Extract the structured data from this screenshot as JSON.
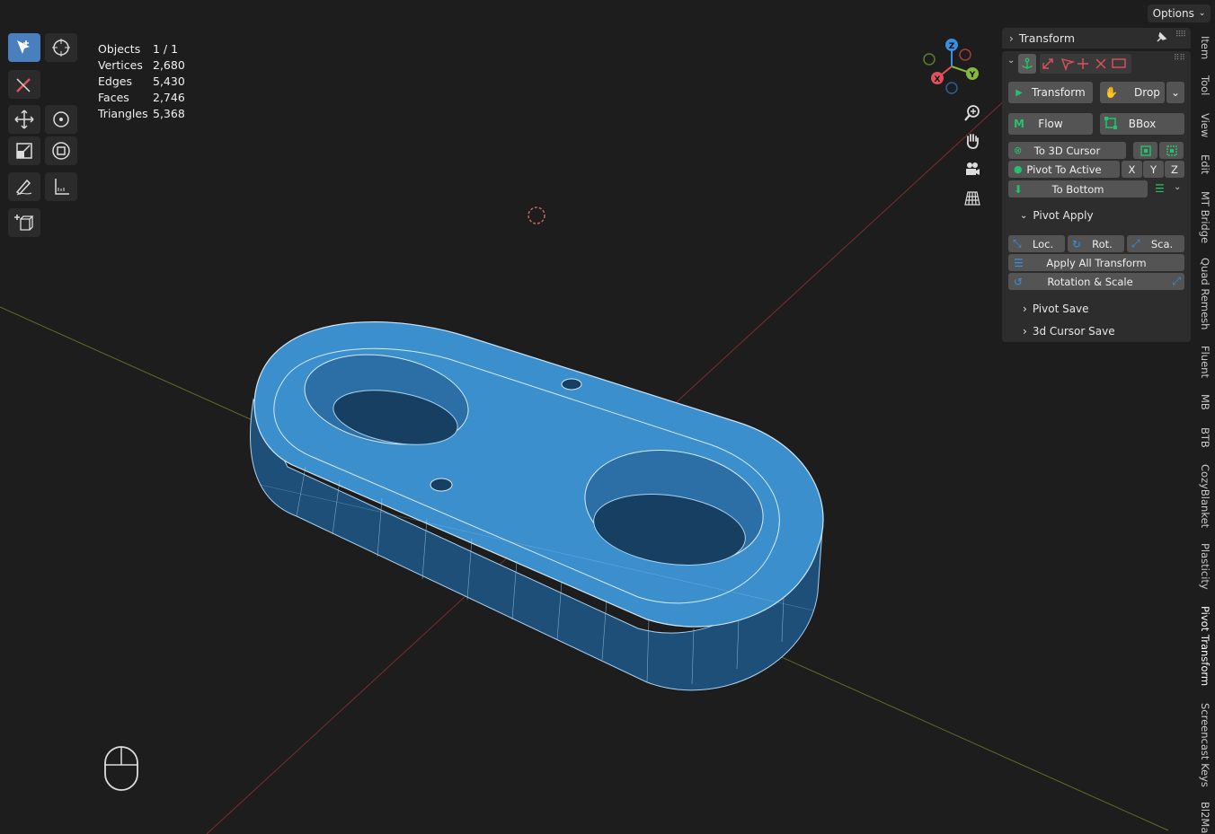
{
  "header": {
    "options_label": "Options"
  },
  "stats": [
    {
      "label": "Objects",
      "value": "1 / 1"
    },
    {
      "label": "Vertices",
      "value": "2,680"
    },
    {
      "label": "Edges",
      "value": "5,430"
    },
    {
      "label": "Faces",
      "value": "2,746"
    },
    {
      "label": "Triangles",
      "value": "5,368"
    }
  ],
  "gizmo": {
    "z": "Z",
    "y": "Y",
    "x": "X"
  },
  "panel": {
    "title": "Transform",
    "transform_btn": "Transform",
    "drop_btn": "Drop",
    "flow_btn": "Flow",
    "bbox_btn": "BBox",
    "to3dcursor_btn": "To 3D Cursor",
    "pivot_to_active_btn": "Pivot To Active",
    "axis_x": "X",
    "axis_y": "Y",
    "axis_z": "Z",
    "to_bottom_btn": "To Bottom",
    "pivot_apply": "Pivot Apply",
    "loc_btn": "Loc.",
    "rot_btn": "Rot.",
    "sca_btn": "Sca.",
    "apply_all_btn": "Apply All Transform",
    "rotation_scale_btn": "Rotation & Scale",
    "pivot_save": "Pivot Save",
    "cursor_save": "3d Cursor Save"
  },
  "sidebar_tabs": [
    "Item",
    "Tool",
    "View",
    "Edit",
    "MT Bridge",
    "Quad Remesh",
    "Fluent",
    "MB",
    "BTB",
    "CozyBlanket",
    "Plasticity",
    "Pivot Transform",
    "Screencast Keys",
    "Bl2Ma"
  ],
  "active_tab": "Pivot Transform",
  "colors": {
    "accent": "#4a7fbf",
    "mesh": "#3b8fcc",
    "green_icon": "#25c26b",
    "red_icon": "#e0505a",
    "axis_x": "#e0505a",
    "axis_y": "#86b83e",
    "axis_z": "#3b8fe0"
  }
}
